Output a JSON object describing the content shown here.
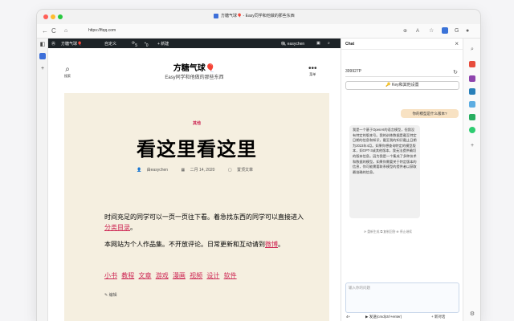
{
  "browser": {
    "tab_title": "方糖气球🎈 - Easy同学和他做的那些东西",
    "url": "https://ftqq.com",
    "nav_back": "←",
    "nav_forward": "→",
    "nav_reload": "C",
    "nav_home": "⌂"
  },
  "wp_admin_bar": {
    "logo": "Ⓦ",
    "site_name": "方糖气球🎈",
    "customize": "自定义",
    "updates": "5",
    "comments": "0",
    "new": "+ 新建",
    "user": "嗨, easychen"
  },
  "header": {
    "search_label": "搜索",
    "site_title": "方糖气球🎈",
    "site_description": "Easy同学和他做的那些东西",
    "menu_label": "菜单"
  },
  "article": {
    "category": "其他",
    "title": "看这里看这里",
    "author": "由easychen",
    "date": "二月 14, 2020",
    "comments": "置顶文章",
    "para1_text": "时间充足的同学可以一页一页往下看。着急找东西的同学可以直接进入",
    "para1_link": "分类目录",
    "para1_end": "。",
    "para2_text": "本网站为个人作品集。不开放评论。日常更新和互动请到",
    "para2_link": "微博",
    "para2_end": "。",
    "tags": [
      "小书",
      "教程",
      "文章",
      "游戏",
      "漫画",
      "视频",
      "设计",
      "软件"
    ],
    "edit": "编辑"
  },
  "chat": {
    "title": "Chat",
    "key_value": "399927P",
    "key_button": "Key和其他设置",
    "user_message": "你的模型是什么版本?",
    "bot_message": "我是一个基于OpenAI的语言模型，但我没有特定的版本号。我的训练数据是截至特定日期的信息和知识，截至我的知识截止日期为2023年4月。如果你想查询特定的模型版本，如GPT-3或其他版本，我无法提供确切的版本信息。因为我是一个集成了多种技术和数据的模型。如果你需要关于特定版本的信息，你可能需要联系模型的提供者以获取最准确的信息。",
    "bot_actions": "⟳ 重新生成  ⧉ 复制回答  ⊕ 停止继续",
    "input_placeholder": "输入你的问题",
    "foot_model": "4+",
    "foot_send": "▶ 发送(cmd|ctrl+enter)",
    "foot_new": "+ 新对话"
  },
  "colors": {
    "accent": "#cd2653",
    "article_bg": "#f5efe0",
    "user_bubble": "#f8e2c3",
    "admin_bar": "#1d2327"
  }
}
